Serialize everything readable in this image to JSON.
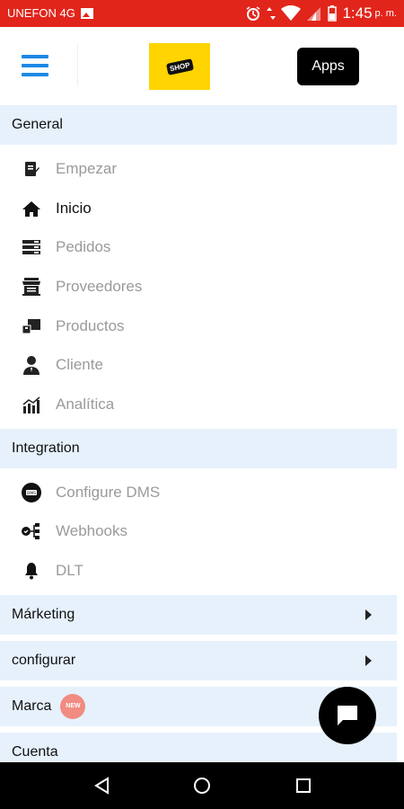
{
  "status_bar": {
    "carrier": "UNEFON 4G",
    "time": "1:45",
    "ampm": "p. m."
  },
  "header": {
    "logo_text": "SHOP",
    "apps_label": "Apps"
  },
  "menu": {
    "general": {
      "title": "General",
      "items": [
        {
          "label": "Empezar",
          "icon": "edit-doc-icon"
        },
        {
          "label": "Inicio",
          "icon": "home-icon"
        },
        {
          "label": "Pedidos",
          "icon": "orders-icon"
        },
        {
          "label": "Proveedores",
          "icon": "store-icon"
        },
        {
          "label": "Productos",
          "icon": "products-icon"
        },
        {
          "label": "Cliente",
          "icon": "customer-icon"
        },
        {
          "label": "Analítica",
          "icon": "analytics-icon"
        }
      ]
    },
    "integration": {
      "title": "Integration",
      "items": [
        {
          "label": "Configure DMS",
          "icon": "dms-icon"
        },
        {
          "label": "Webhooks",
          "icon": "webhooks-icon"
        },
        {
          "label": "DLT",
          "icon": "bell-icon"
        }
      ]
    },
    "marketing": {
      "title": "Márketing"
    },
    "configurar": {
      "title": "configurar"
    },
    "marca": {
      "title": "Marca",
      "badge": "NEW"
    },
    "cuenta": {
      "title": "Cuenta"
    }
  },
  "colors": {
    "status_bar": "#e1251b",
    "accent_blue": "#1e88e5",
    "section_bg": "#e6f1fc",
    "logo_yellow": "#ffd400",
    "inactive_text": "#9a9a9a"
  }
}
